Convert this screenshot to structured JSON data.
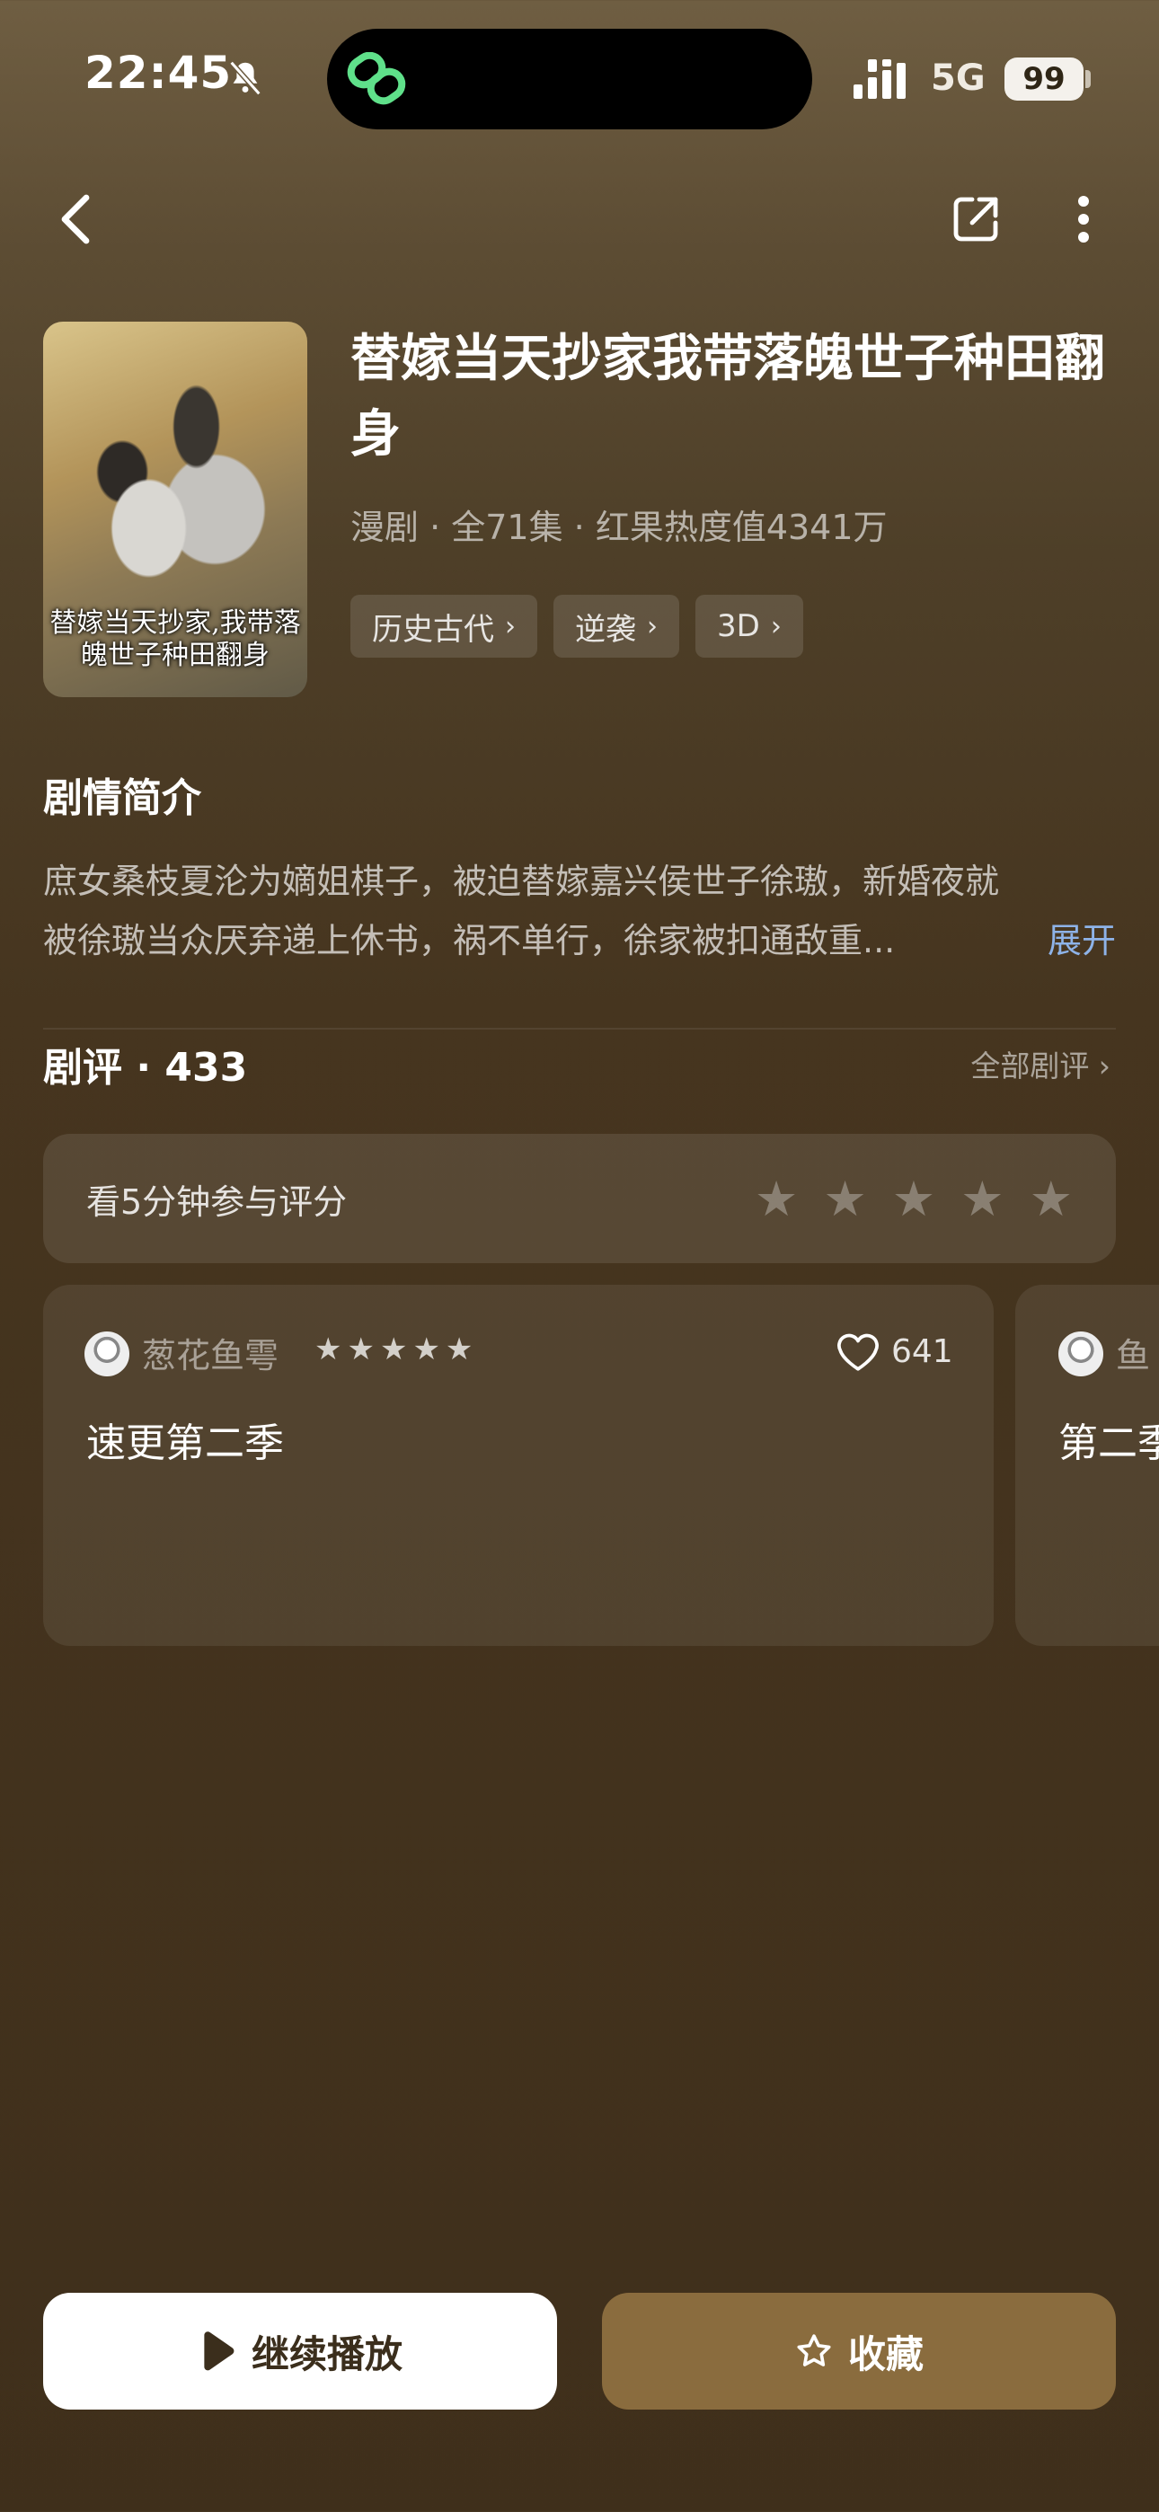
{
  "status_bar": {
    "time": "22:45",
    "network": "5G",
    "battery": "99"
  },
  "drama": {
    "poster_title": "替嫁当天抄家,我带落魄世子种田翻身",
    "title": "替嫁当天抄家我带落魄世子种田翻身",
    "meta": "漫剧 · 全71集 · 红果热度值4341万",
    "tags": [
      {
        "label": "历史古代"
      },
      {
        "label": "逆袭"
      },
      {
        "label": "3D"
      }
    ]
  },
  "synopsis": {
    "heading": "剧情简介",
    "line1": "庶女桑枝夏沦为嫡姐棋子，被迫替嫁嘉兴侯世子徐璈，新婚夜就",
    "line2": "被徐璈当众厌弃递上休书，祸不单行，徐家被扣通敌重...",
    "expand_label": "展开"
  },
  "reviews": {
    "heading": "剧评 · 433",
    "all_label": "全部剧评",
    "rate_prompt": "看5分钟参与评分",
    "rate_stars": 5,
    "items": [
      {
        "user": "葱花鱼雩",
        "stars": 5,
        "likes": "641",
        "text": "速更第二季"
      },
      {
        "user": "鱼",
        "text": "第二季"
      }
    ]
  },
  "actions": {
    "play_label": "继续播放",
    "favorite_label": "收藏"
  },
  "colors": {
    "accent_button": "#8a6c3e",
    "expand_link": "#8eb3e8"
  }
}
